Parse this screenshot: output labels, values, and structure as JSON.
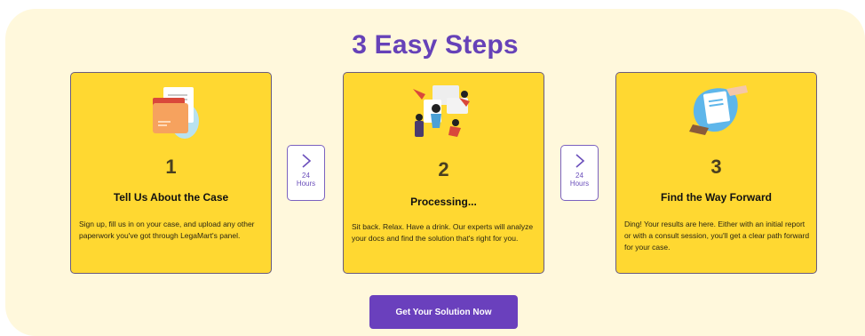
{
  "heading": "3 Easy Steps",
  "steps": [
    {
      "number": "1",
      "title": "Tell Us About the Case",
      "description": "Sign up, fill us in on your case, and upload any other paperwork you've got through LegaMart's panel.",
      "illustration": "folder-documents-icon"
    },
    {
      "number": "2",
      "title": "Processing...",
      "description": "Sit back. Relax. Have a drink. Our experts will analyze your docs and find the solution that's right for you.",
      "illustration": "team-processing-illustration"
    },
    {
      "number": "3",
      "title": "Find the Way Forward",
      "description": "Ding! Your results are here. Either with an initial report or with a consult session, you'll get a clear path forward for your case.",
      "illustration": "handover-document-icon"
    }
  ],
  "connectors": [
    {
      "number": "24",
      "unit": "Hours",
      "icon": "chevron-right-icon"
    },
    {
      "number": "24",
      "unit": "Hours",
      "icon": "chevron-right-icon"
    }
  ],
  "cta": {
    "label": "Get Your Solution Now"
  },
  "colors": {
    "section_bg": "#fff8dc",
    "card_bg": "#ffd831",
    "accent_purple": "#6a40bd",
    "heading": "#6642b8"
  }
}
